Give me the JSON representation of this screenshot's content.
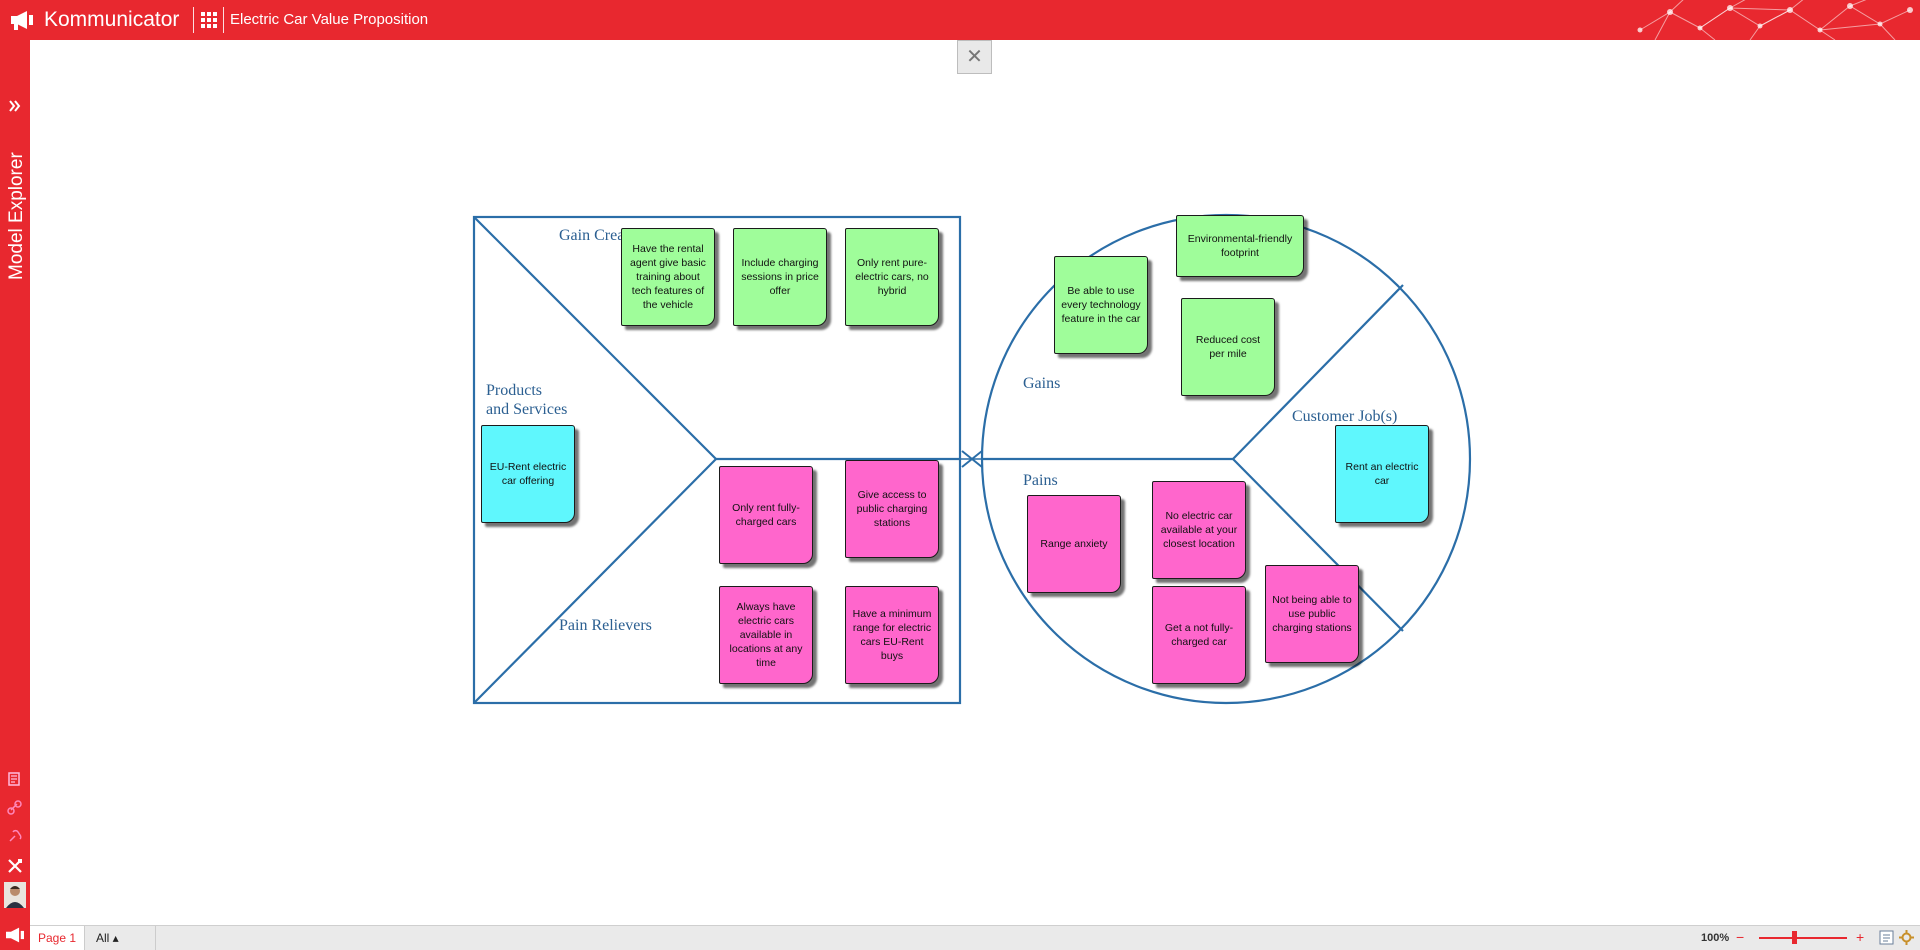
{
  "header": {
    "app_name": "Kommunicator",
    "document_title": "Electric Car Value Proposition"
  },
  "sidebar": {
    "explorer_label": "Model Explorer"
  },
  "canvas": {
    "close_symbol": "✕",
    "value_map": {
      "gain_creators_label": "Gain Creators",
      "products_label_line1": "Products",
      "products_label_line2": "and Services",
      "pain_relievers_label": "Pain Relievers",
      "gain_creators": [
        "Have the rental agent give basic training about tech features of the vehicle",
        "Include charging sessions in price offer",
        "Only rent pure-electric cars, no hybrid"
      ],
      "products": [
        "EU-Rent electric car offering"
      ],
      "pain_relievers": [
        "Only rent fully-charged cars",
        "Give access to public charging stations",
        "Always have electric cars available in locations at any time",
        "Have a minimum range for electric cars EU-Rent buys"
      ]
    },
    "customer_profile": {
      "gains_label": "Gains",
      "pains_label": "Pains",
      "jobs_label": "Customer Job(s)",
      "gains": [
        "Environmental-friendly footprint",
        "Be able to use every technology feature in the car",
        "Reduced cost per mile"
      ],
      "jobs": [
        "Rent an electric car"
      ],
      "pains": [
        "Range anxiety",
        "No electric car available at your closest location",
        "Get a not fully-charged car",
        "Not being able to use public charging stations"
      ]
    }
  },
  "footer": {
    "page_tab": "Page 1",
    "filter_label": "All ▴",
    "zoom_level": "100%",
    "zoom_minus": "−",
    "zoom_plus": "+"
  },
  "colors": {
    "brand_red": "#e8282f",
    "gain_green": "#9ffd9a",
    "pain_pink": "#ff66cc",
    "product_cyan": "#5ff7fd",
    "frame_blue": "#2b6ea8"
  },
  "icons": [
    "kommunicator-logo-icon",
    "app-grid-icon",
    "network-pattern-icon",
    "double-chevron-right-icon",
    "page-list-icon",
    "link-icon",
    "chain-icon",
    "tools-icon",
    "close-icon",
    "fit-page-icon",
    "settings-icon"
  ]
}
